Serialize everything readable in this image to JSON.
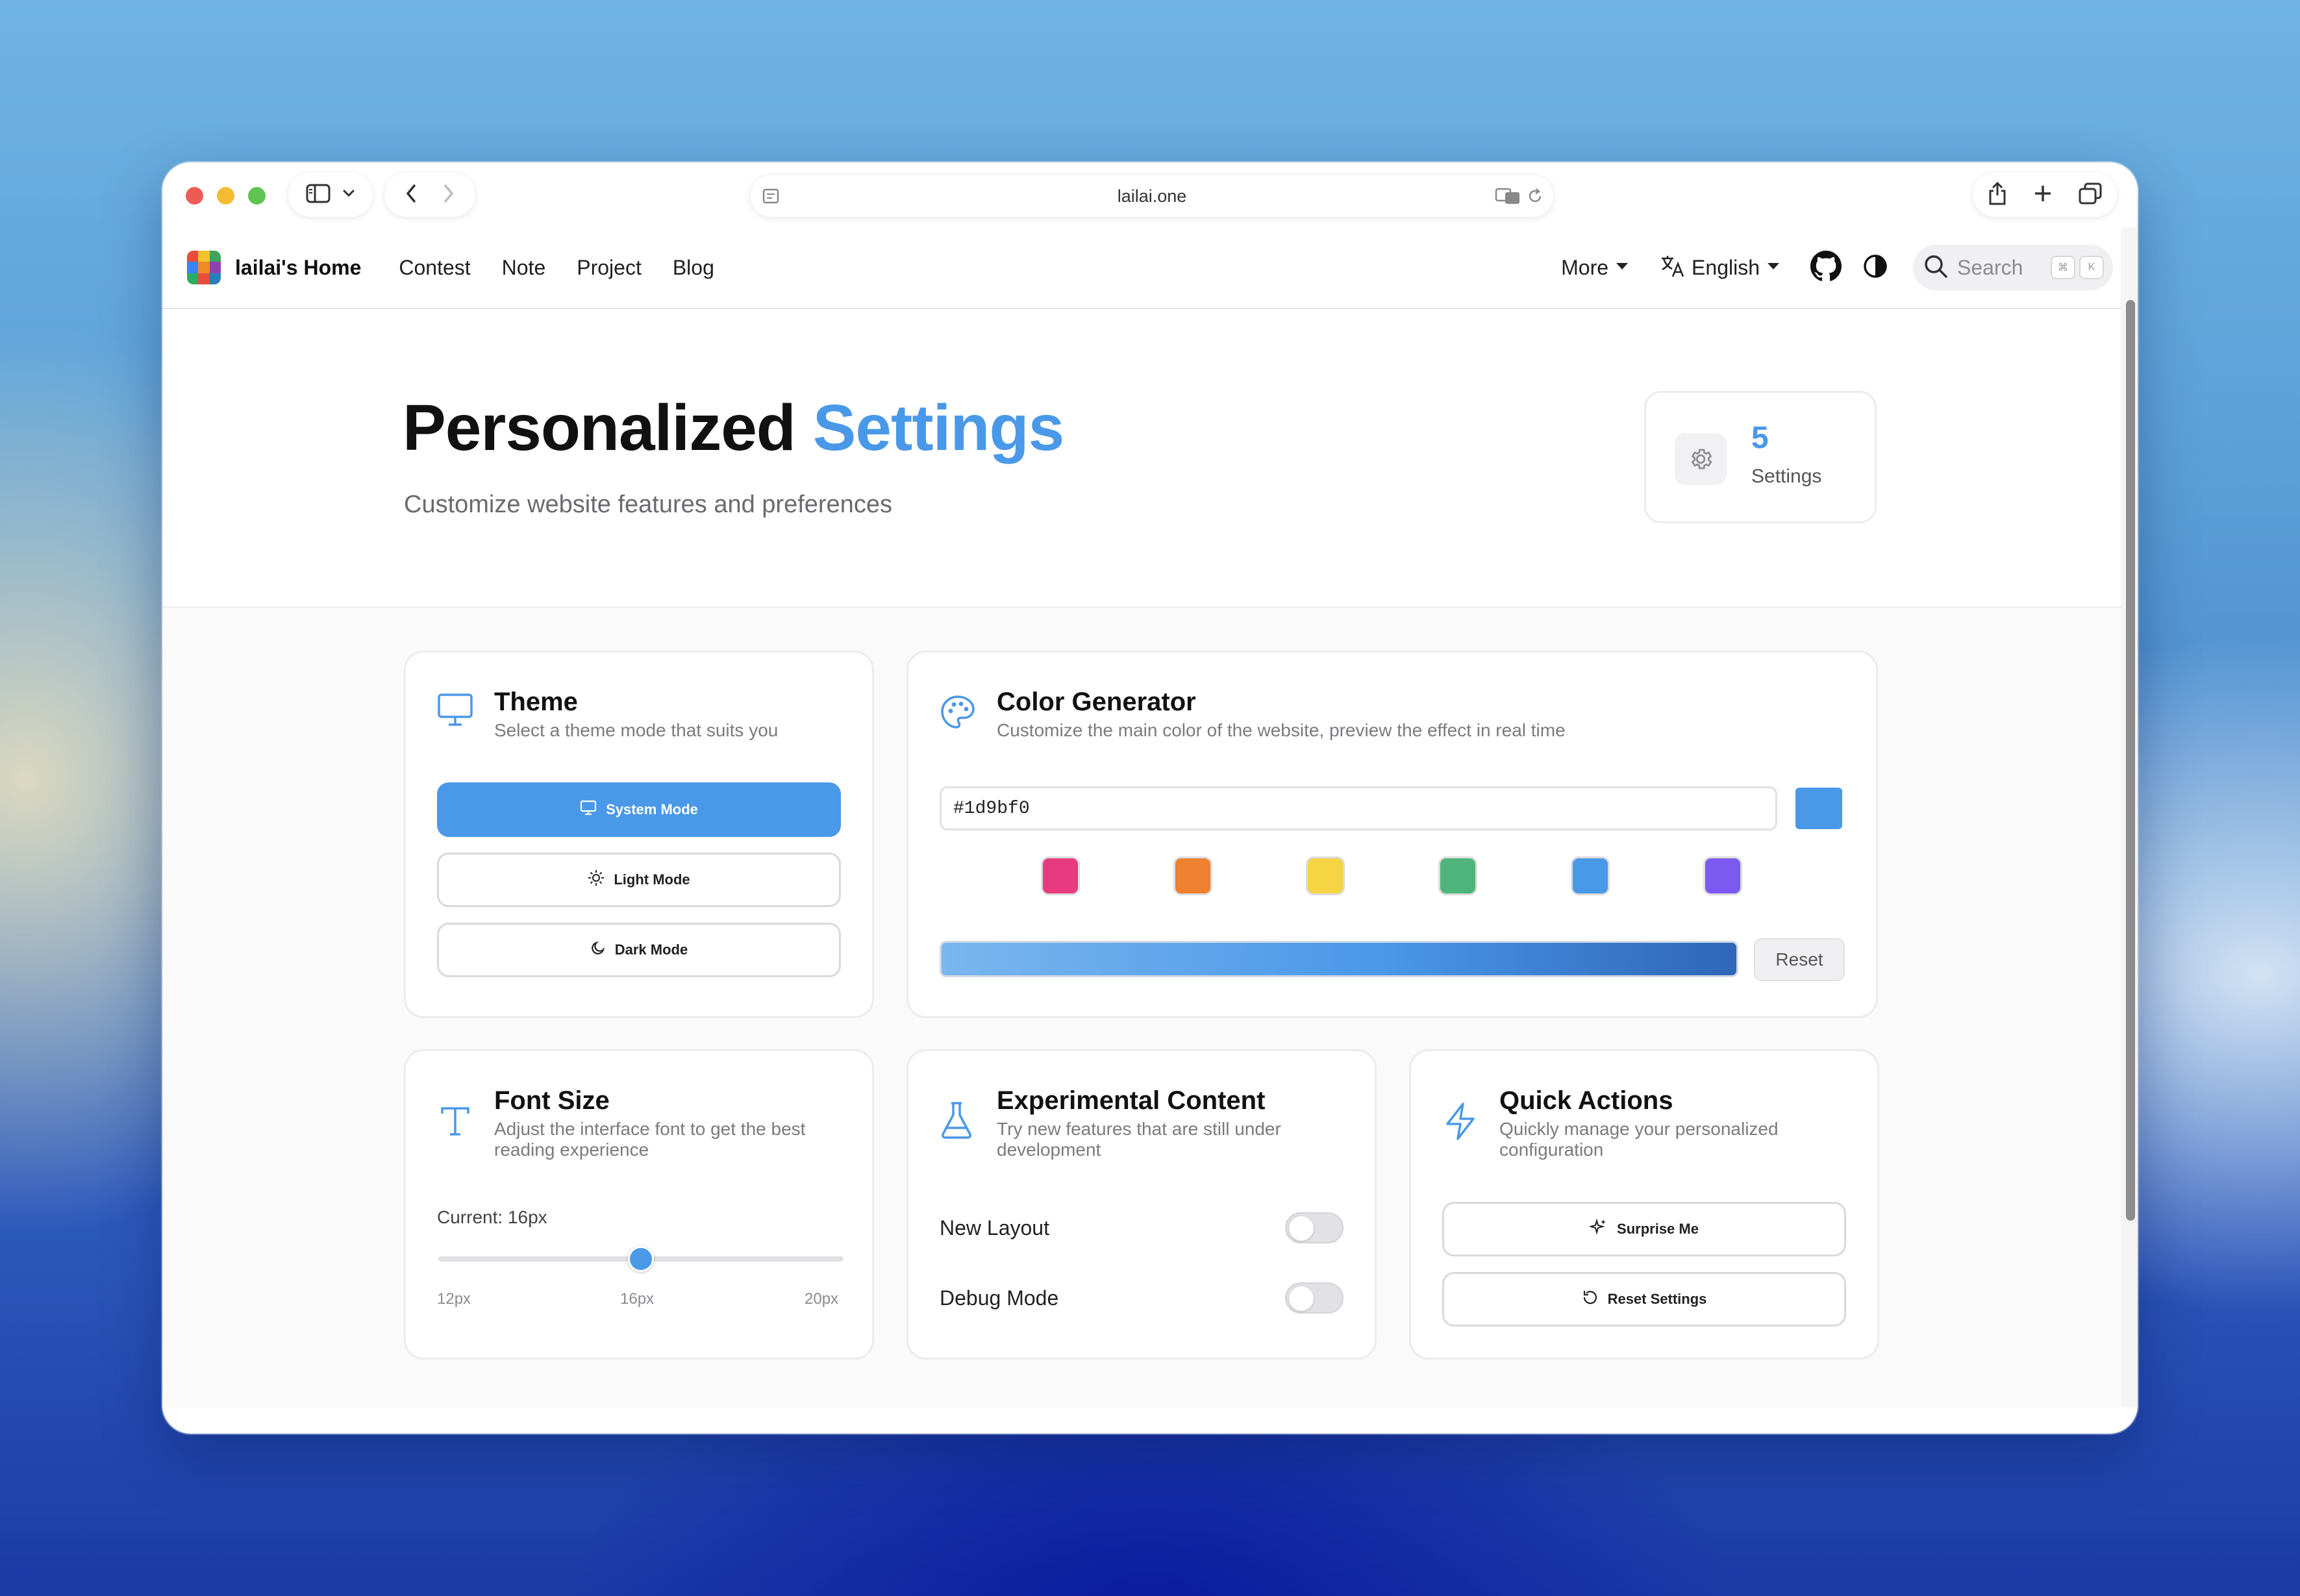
{
  "browser": {
    "url": "lailai.one"
  },
  "site": {
    "brand": "lailai's Home",
    "nav": [
      "Contest",
      "Note",
      "Project",
      "Blog"
    ],
    "more": "More",
    "language": "English",
    "search_placeholder": "Search",
    "shortcut_keys": [
      "⌘",
      "K"
    ]
  },
  "hero": {
    "title_main": "Personalized",
    "title_accent": "Settings",
    "subtitle": "Customize website features and preferences",
    "stat_value": "5",
    "stat_label": "Settings"
  },
  "theme": {
    "title": "Theme",
    "desc": "Select a theme mode that suits you",
    "options": [
      "System Mode",
      "Light Mode",
      "Dark Mode"
    ],
    "selected": "System Mode"
  },
  "color": {
    "title": "Color Generator",
    "desc": "Customize the main color of the website, preview the effect in real time",
    "value": "#1d9bf0",
    "preview_color": "#4a98e8",
    "swatches": [
      "#e83a7f",
      "#ee8030",
      "#f6d443",
      "#4fb47c",
      "#4a98e8",
      "#7a5af0"
    ],
    "reset": "Reset"
  },
  "font": {
    "title": "Font Size",
    "desc": "Adjust the interface font to get the best reading experience",
    "current_label": "Current: 16px",
    "value": 16,
    "min": 12,
    "max": 20,
    "ticks": [
      "12px",
      "16px",
      "20px"
    ]
  },
  "experimental": {
    "title": "Experimental Content",
    "desc": "Try new features that are still under development",
    "items": [
      {
        "label": "New Layout",
        "enabled": false
      },
      {
        "label": "Debug Mode",
        "enabled": false
      }
    ]
  },
  "quick": {
    "title": "Quick Actions",
    "desc": "Quickly manage your personalized configuration",
    "buttons": [
      "Surprise Me",
      "Reset Settings"
    ]
  },
  "colors": {
    "accent": "#4a98e8",
    "text": "#111111",
    "muted": "#7a7a80"
  }
}
